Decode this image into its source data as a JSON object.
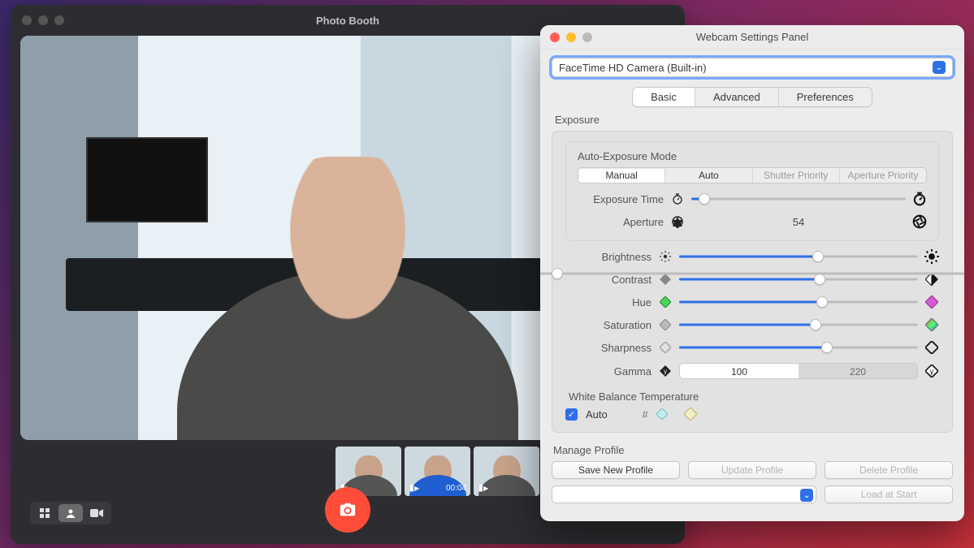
{
  "photo_booth": {
    "title": "Photo Booth",
    "thumbs": [
      {
        "cam_icon": true,
        "timer": ""
      },
      {
        "cam_icon": true,
        "timer": "00:04"
      },
      {
        "cam_icon": true,
        "timer": ""
      }
    ]
  },
  "wsp": {
    "title": "Webcam Settings Panel",
    "camera": "FaceTime HD Camera (Built-in)",
    "tabs": {
      "basic": "Basic",
      "advanced": "Advanced",
      "preferences": "Preferences",
      "selected": "basic"
    },
    "exposure": {
      "group_label": "Exposure",
      "mode_label": "Auto-Exposure Mode",
      "modes": {
        "manual": "Manual",
        "auto": "Auto",
        "shutter": "Shutter Priority",
        "aperture": "Aperture Priority",
        "selected": "manual"
      },
      "exposure_time_label": "Exposure Time",
      "exposure_time_pct": 6,
      "aperture_label": "Aperture",
      "aperture_value": "54",
      "sliders": {
        "brightness": {
          "label": "Brightness",
          "pct": 58
        },
        "contrast": {
          "label": "Contrast",
          "pct": 59
        },
        "hue": {
          "label": "Hue",
          "pct": 60
        },
        "saturation": {
          "label": "Saturation",
          "pct": 57
        },
        "sharpness": {
          "label": "Sharpness",
          "pct": 62
        }
      },
      "gamma_label": "Gamma",
      "gamma_a": "100",
      "gamma_b": "220"
    },
    "white_balance": {
      "title": "White Balance Temperature",
      "auto_label": "Auto",
      "auto_checked": true,
      "hash": "#",
      "pct": 4
    },
    "manage_profile": {
      "title": "Manage Profile",
      "save": "Save New Profile",
      "update": "Update Profile",
      "delete": "Delete Profile",
      "load": "Load at Start"
    }
  }
}
